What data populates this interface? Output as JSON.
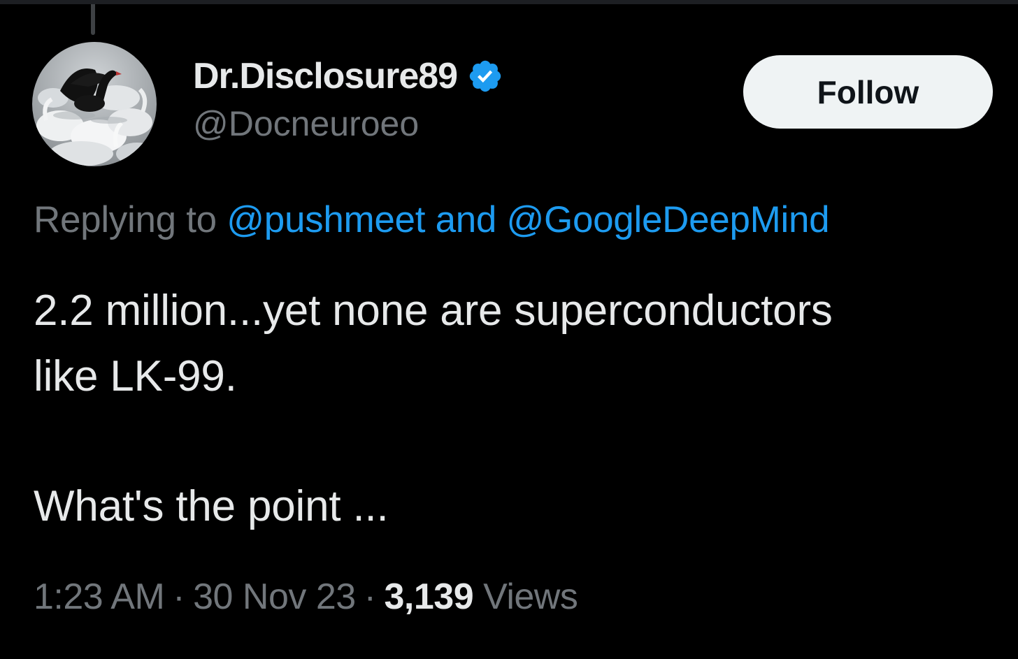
{
  "theme": {
    "background": "#000000",
    "text_primary": "#e7e9ea",
    "text_secondary": "#71767b",
    "link": "#1d9bf0",
    "verified_badge": "#1d9bf0",
    "follow_button_bg": "#eff3f4"
  },
  "author": {
    "display_name": "Dr.Disclosure89",
    "handle": "@Docneuroeo",
    "verified_icon": "verified-badge-icon",
    "avatar": "black swan among white swans"
  },
  "follow_button": {
    "label": "Follow"
  },
  "reply_context": {
    "prefix": "Replying to ",
    "mention_1": "@pushmeet",
    "joiner": " and ",
    "mention_2": "@GoogleDeepMind"
  },
  "tweet": {
    "line_1": "2.2 million...yet none are superconductors",
    "line_2": "like LK-99.",
    "line_3": "What's the point ..."
  },
  "meta": {
    "time": "1:23 AM",
    "separator": "·",
    "date": "30 Nov 23",
    "views_count": "3,139",
    "views_label": "Views"
  }
}
